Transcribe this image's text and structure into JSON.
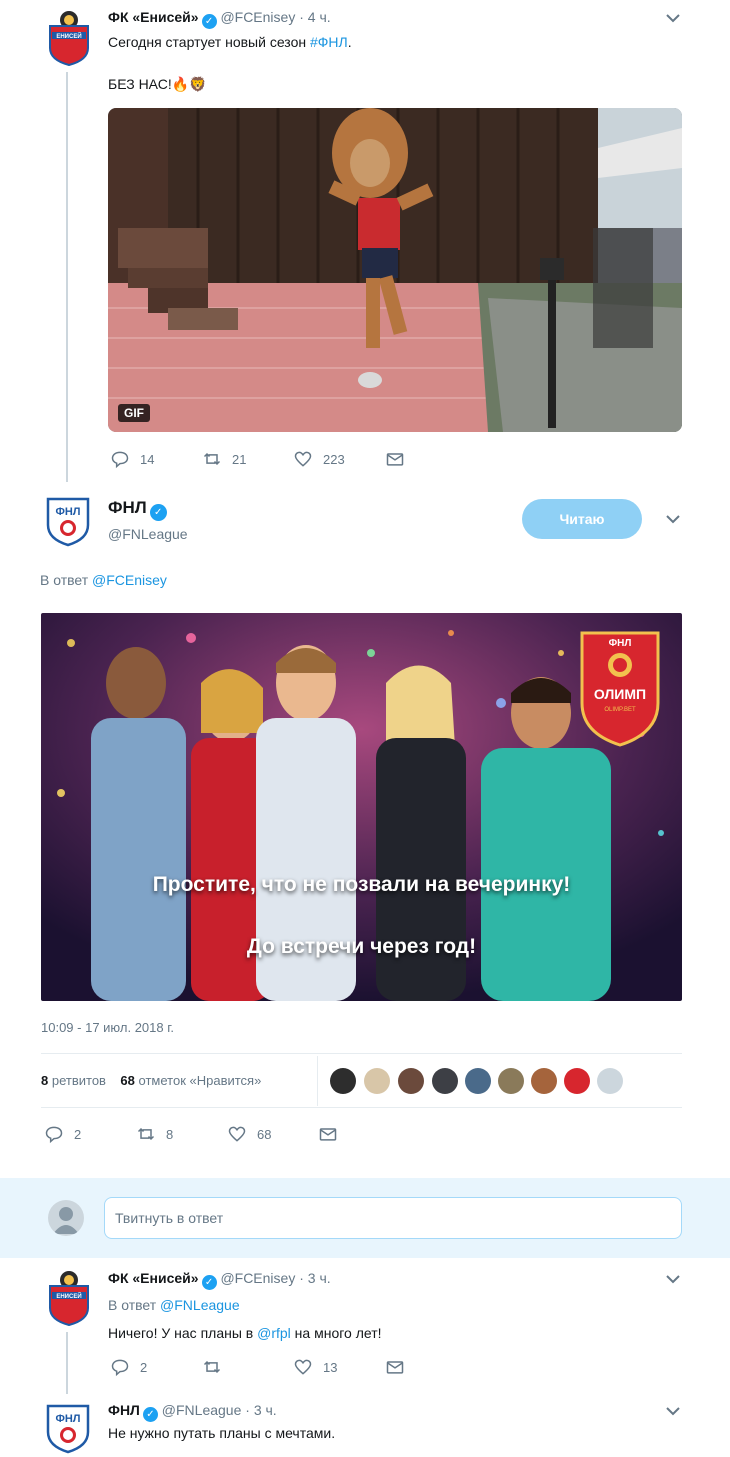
{
  "tweet1": {
    "name": "ФК «Енисей»",
    "handle": "@FCEnisey",
    "time": "· 4 ч.",
    "text_main": "Сегодня стартует новый сезон ",
    "hashtag": "#ФНЛ",
    "hashtag_after": ".",
    "text2": "БЕЗ НАС!🔥🦁",
    "gif_label": "GIF",
    "replies": "14",
    "retweets": "21",
    "likes": "223"
  },
  "tweet2": {
    "name": "ФНЛ",
    "handle": "@FNLeague",
    "follow_label": "Читаю",
    "reply_to_prefix": "В ответ ",
    "reply_to_handle": "@FCEnisey",
    "image_text_line1": "Простите, что не позвали на вечеринку!",
    "image_text_line2": "До встречи через год!",
    "logo_top": "ФНЛ",
    "logo_main": "ОЛИМП",
    "logo_site": "OLIMP.BET",
    "timestamp": "10:09 - 17 июл. 2018 г.",
    "retweets_count": "8",
    "retweets_label": "ретвитов",
    "likes_count": "68",
    "likes_label": "отметок «Нравится»",
    "replies": "2",
    "retweets": "8",
    "likes": "68"
  },
  "reply_box": {
    "placeholder": "Твитнуть в ответ"
  },
  "tweet3": {
    "name": "ФК «Енисей»",
    "handle": "@FCEnisey",
    "time": "· 3 ч.",
    "reply_to_prefix": "В ответ ",
    "reply_to_handle": "@FNLeague",
    "text_before": "Ничего! У нас планы в ",
    "mention": "@rfpl",
    "text_after": " на много лет!",
    "replies": "2",
    "likes": "13"
  },
  "tweet4": {
    "name": "ФНЛ",
    "handle": "@FNLeague",
    "time": "· 3 ч.",
    "text": "Не нужно путать планы с мечтами."
  },
  "logo_enisey_text": "ЕНИСЕЙ",
  "logo_fnl_text": "ФНЛ",
  "colors": {
    "link": "#1b95e0",
    "muted": "#657786",
    "follow_button": "#8fd0f5",
    "enisey_red": "#d7262e",
    "fnl_blue": "#1f5aa6"
  }
}
